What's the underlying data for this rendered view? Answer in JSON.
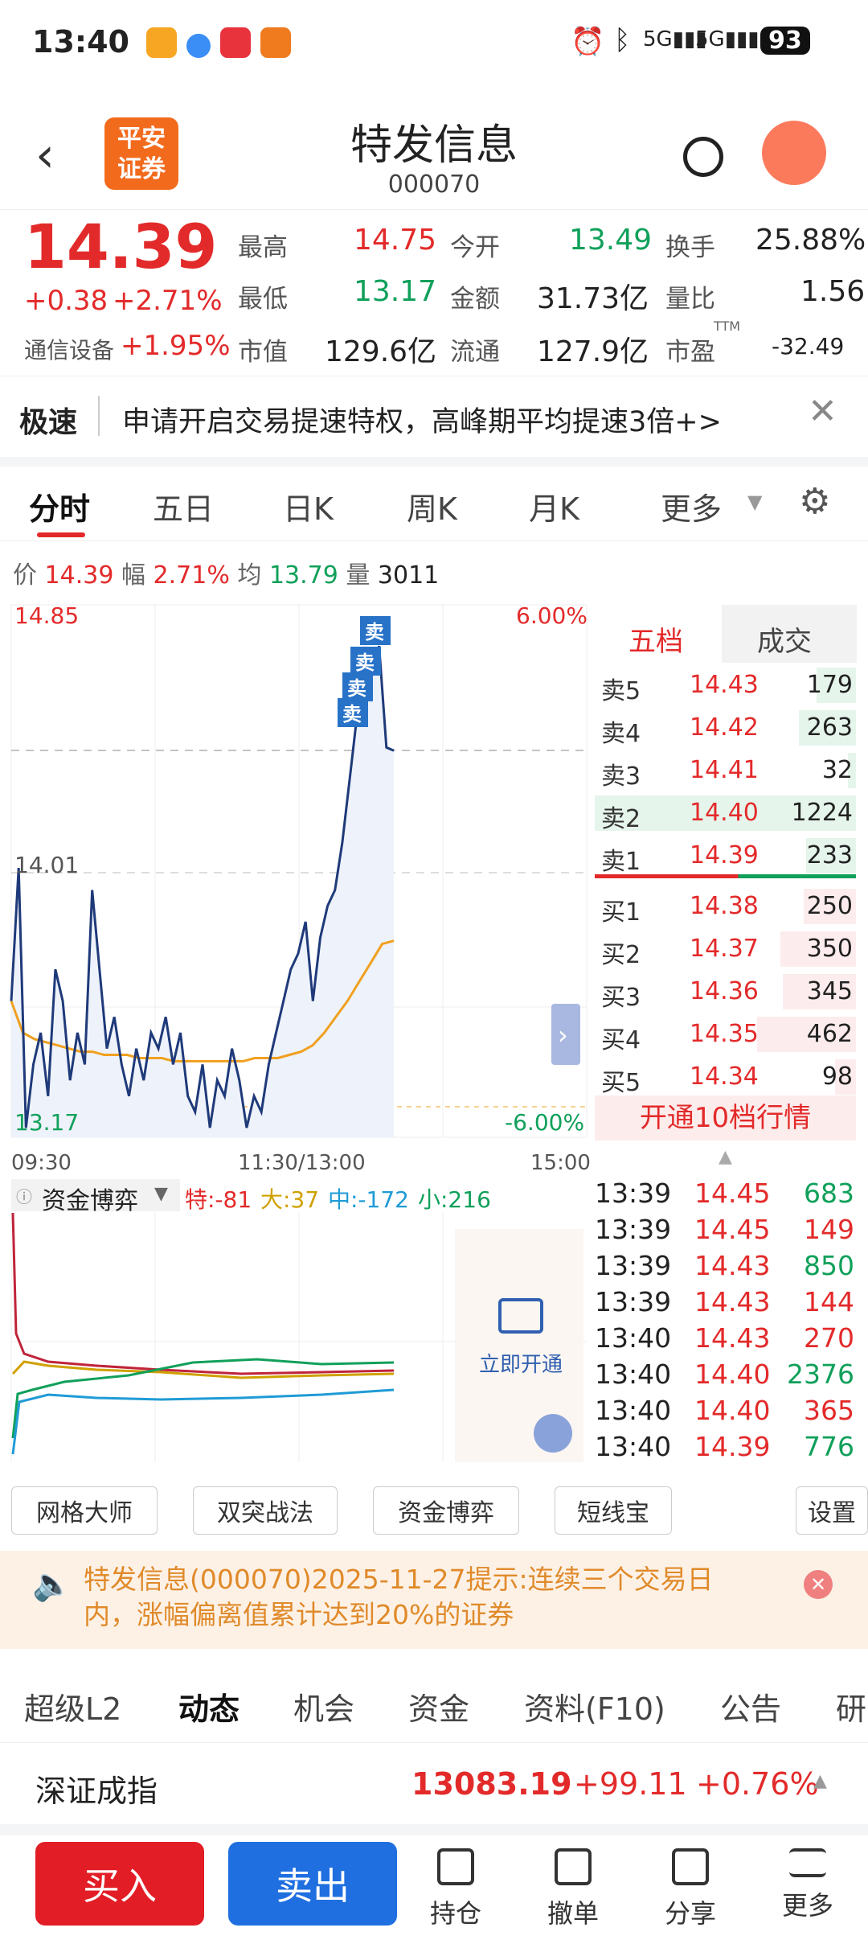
{
  "status": {
    "time": "13:40",
    "battery": "93"
  },
  "header": {
    "broker_logo": "平安\n证券",
    "stock_name": "特发信息",
    "stock_code": "000070"
  },
  "quote": {
    "price": "14.39",
    "change": "+0.38",
    "change_pct": "+2.71%",
    "sector_name": "通信设备",
    "sector_pct": "+1.95%",
    "fields": [
      {
        "label": "最高",
        "value": "14.75"
      },
      {
        "label": "今开",
        "value": "13.49"
      },
      {
        "label": "换手",
        "value": "25.88%"
      },
      {
        "label": "最低",
        "value": "13.17"
      },
      {
        "label": "金额",
        "value": "31.73亿"
      },
      {
        "label": "量比",
        "value": "1.56"
      },
      {
        "label": "市值",
        "value": "129.6亿"
      },
      {
        "label": "流通",
        "value": "127.9亿"
      },
      {
        "label": "市盈",
        "value": "-32.49"
      }
    ],
    "ttm": "TTM"
  },
  "banner": {
    "tag": "极速",
    "text": "申请开启交易提速特权，高峰期平均提速3倍+>"
  },
  "chart_tabs": [
    "分时",
    "五日",
    "日K",
    "周K",
    "月K",
    "更多"
  ],
  "infobar": {
    "price_label": "价",
    "price": "14.39",
    "amp_label": "幅",
    "amp": "2.71%",
    "avg_label": "均",
    "avg": "13.79",
    "vol_label": "量",
    "vol": "3011"
  },
  "chart": {
    "y_top": "14.85",
    "y_mid": "14.01",
    "y_bottom": "13.17",
    "pct_top": "6.00%",
    "pct_bottom": "-6.00%",
    "x_labels": [
      "09:30",
      "11:30/13:00",
      "15:00"
    ],
    "sell_marker": "卖"
  },
  "chart_data": {
    "type": "line",
    "ylim": [
      13.17,
      14.85
    ],
    "series": [
      {
        "values": [
          13.6,
          14.02,
          13.2,
          13.4,
          13.5,
          13.3,
          13.7,
          13.6,
          13.35,
          13.5,
          13.4,
          13.95,
          13.7,
          13.45,
          13.55,
          13.4,
          13.3,
          13.45,
          13.35,
          13.5,
          13.45,
          13.55,
          13.4,
          13.5,
          13.3,
          13.25,
          13.4,
          13.2,
          13.35,
          13.3,
          13.45,
          13.35,
          13.2,
          13.3,
          13.25,
          13.4,
          13.5,
          13.6,
          13.7,
          13.75,
          13.85,
          13.6,
          13.8,
          13.9,
          13.95,
          14.1,
          14.3,
          14.5,
          14.6,
          14.65,
          14.72,
          14.4,
          14.39
        ]
      },
      {
        "values": [
          13.6,
          13.5,
          13.48,
          13.47,
          13.46,
          13.45,
          13.44,
          13.44,
          13.43,
          13.43,
          13.43,
          13.42,
          13.42,
          13.42,
          13.41,
          13.41,
          13.41,
          13.41,
          13.41,
          13.41,
          13.41,
          13.42,
          13.42,
          13.42,
          13.43,
          13.44,
          13.46,
          13.5,
          13.55,
          13.6,
          13.66,
          13.72,
          13.78,
          13.79
        ]
      }
    ]
  },
  "orderbook": {
    "tabs": [
      "五档",
      "成交"
    ],
    "rows": [
      {
        "label": "卖5",
        "price": "14.43",
        "vol": "179",
        "side": "sell",
        "level": 0.15
      },
      {
        "label": "卖4",
        "price": "14.42",
        "vol": "263",
        "side": "sell",
        "level": 0.22
      },
      {
        "label": "卖3",
        "price": "14.41",
        "vol": "32",
        "side": "sell",
        "level": 0.03
      },
      {
        "label": "卖2",
        "price": "14.40",
        "vol": "1224",
        "side": "sell",
        "level": 1.0
      },
      {
        "label": "卖1",
        "price": "14.39",
        "vol": "233",
        "side": "sell",
        "level": 0.19
      },
      {
        "label": "买1",
        "price": "14.38",
        "vol": "250",
        "side": "buy",
        "level": 0.2
      },
      {
        "label": "买2",
        "price": "14.37",
        "vol": "350",
        "side": "buy",
        "level": 0.29
      },
      {
        "label": "买3",
        "price": "14.36",
        "vol": "345",
        "side": "buy",
        "level": 0.28
      },
      {
        "label": "买4",
        "price": "14.35",
        "vol": "462",
        "side": "buy",
        "level": 0.38
      },
      {
        "label": "买5",
        "price": "14.34",
        "vol": "98",
        "side": "buy",
        "level": 0.08
      }
    ],
    "open10": "开通10档行情"
  },
  "trades": [
    {
      "time": "13:39",
      "price": "14.45",
      "vol": "683",
      "dir": "green"
    },
    {
      "time": "13:39",
      "price": "14.45",
      "vol": "149",
      "dir": "red"
    },
    {
      "time": "13:39",
      "price": "14.43",
      "vol": "850",
      "dir": "green"
    },
    {
      "time": "13:39",
      "price": "14.43",
      "vol": "144",
      "dir": "red"
    },
    {
      "time": "13:40",
      "price": "14.43",
      "vol": "270",
      "dir": "red"
    },
    {
      "time": "13:40",
      "price": "14.40",
      "vol": "2376",
      "dir": "green"
    },
    {
      "time": "13:40",
      "price": "14.40",
      "vol": "365",
      "dir": "red"
    },
    {
      "time": "13:40",
      "price": "14.39",
      "vol": "776",
      "dir": "green"
    }
  ],
  "fund": {
    "title": "资金博弈",
    "te": "特:-81",
    "da": "大:37",
    "zhong": "中:-172",
    "xiao": "小:216",
    "unlock": "立即开通"
  },
  "tools": [
    "网格大师",
    "双突战法",
    "资金博弈",
    "短线宝",
    "设置"
  ],
  "notice": {
    "text": "特发信息(000070)2025-11-27提示:连续三个交易日内，涨幅偏离值累计达到20%的证券"
  },
  "subtabs": [
    "超级L2",
    "动态",
    "机会",
    "资金",
    "资料(F10)",
    "公告",
    "研"
  ],
  "index": {
    "name": "深证成指",
    "value": "13083.19",
    "change": "+99.11",
    "pct": "+0.76%"
  },
  "bottom": {
    "buy": "买入",
    "sell": "卖出",
    "items": [
      "持仓",
      "撤单",
      "分享",
      "更多"
    ]
  },
  "colors": {
    "up": "#e32a2a",
    "down": "#10a05a",
    "primary": "#1f6fd6",
    "price_line": "#1f3a7a",
    "avg_line": "#f0a020"
  }
}
